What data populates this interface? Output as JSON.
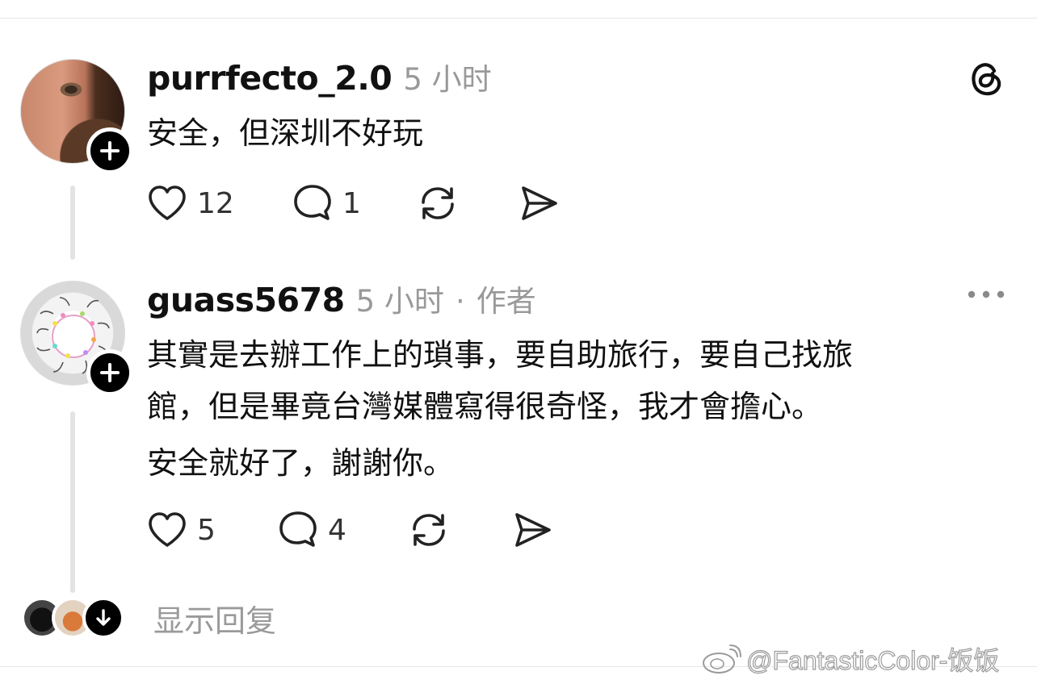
{
  "posts": [
    {
      "username": "purrfecto_2.0",
      "time": "5 小时",
      "lines": [
        "安全，但深圳不好玩"
      ],
      "likes": "12",
      "replies": "1",
      "header_icon": "threads-logo-icon"
    },
    {
      "username": "guass5678",
      "time": "5 小时",
      "separator": "·",
      "author_tag": "作者",
      "lines": [
        "其實是去辦工作上的瑣事，要自助旅行，要自己找旅",
        "館，但是畢竟台灣媒體寫得很奇怪，我才會擔心。",
        "安全就好了，謝謝你。"
      ],
      "likes": "5",
      "replies": "4",
      "header_icon": "more-icon"
    }
  ],
  "show_replies": {
    "label": "显示回复"
  },
  "watermark": {
    "text": "@FantasticColor-饭饭"
  },
  "colors": {
    "text": "#111111",
    "secondary": "#999999",
    "divider": "#e6e6e6",
    "thread_line": "#e3e3e3"
  }
}
